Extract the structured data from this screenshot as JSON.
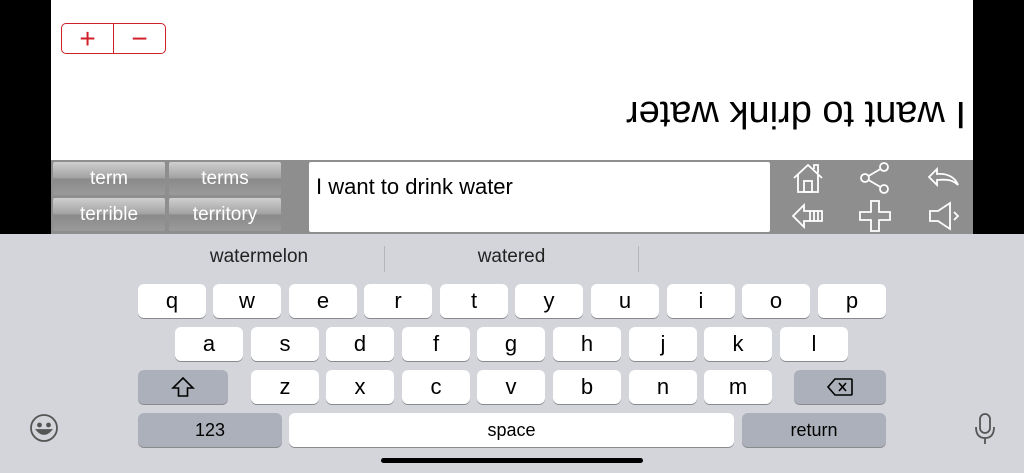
{
  "zoom": {
    "plus": "+",
    "minus": "−"
  },
  "flipped_text": "I want to drink water",
  "predictions": [
    "term",
    "terms",
    "terrible",
    "territory"
  ],
  "output_text": "I want to drink water",
  "tools": [
    "home-icon",
    "share-icon",
    "undo-icon",
    "backspace-icon",
    "add-icon",
    "speaker-icon"
  ],
  "suggestions": [
    "watermelon",
    "watered",
    ""
  ],
  "keyboard": {
    "row1": [
      "q",
      "w",
      "e",
      "r",
      "t",
      "y",
      "u",
      "i",
      "o",
      "p"
    ],
    "row2": [
      "a",
      "s",
      "d",
      "f",
      "g",
      "h",
      "j",
      "k",
      "l"
    ],
    "row3": [
      "z",
      "x",
      "c",
      "v",
      "b",
      "n",
      "m"
    ],
    "shift_icon": "shift-icon",
    "delete_icon": "delete-icon",
    "numbers_label": "123",
    "space_label": "space",
    "return_label": "return",
    "emoji_icon": "emoji-icon",
    "mic_icon": "microphone-icon"
  }
}
